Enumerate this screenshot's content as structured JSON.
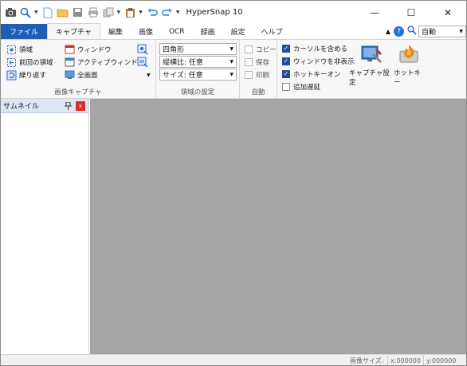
{
  "app": {
    "title": "HyperSnap 10"
  },
  "window_controls": {
    "minimize": "—",
    "maximize": "☐",
    "close": "✕"
  },
  "tabs": [
    {
      "label": "ファイル"
    },
    {
      "label": "キャプチャ"
    },
    {
      "label": "編集"
    },
    {
      "label": "画像"
    },
    {
      "label": "OCR"
    },
    {
      "label": "録画"
    },
    {
      "label": "設定"
    },
    {
      "label": "ヘルプ"
    }
  ],
  "zoom": {
    "value": "自動"
  },
  "ribbon": {
    "capture_group": {
      "label": "画像キャプチャ",
      "region": "領域",
      "prev_region": "前回の領域",
      "repeat": "繰り返す",
      "window": "ウィンドウ",
      "active_window": "アクティブウィンドウ",
      "full_screen": "全画面"
    },
    "region_group": {
      "label": "領域の設定",
      "shape": "四角形",
      "aspect": "縦横比: 任意",
      "size": "サイズ: 任意"
    },
    "auto_group": {
      "label": "自動",
      "copy": "コピー",
      "save": "保存",
      "print": "印刷"
    },
    "options_group": {
      "include_cursor": "カーソルを含める",
      "hide_window": "ウィンドウを非表示",
      "hotkey_on": "ホットキーオン",
      "add_delay": "追加遅延"
    },
    "big_buttons": {
      "capture_settings": "キャプチャ設定",
      "hotkeys": "ホットキー"
    }
  },
  "side_panel": {
    "title": "サムネイル",
    "close": "x"
  },
  "status": {
    "image_size_label": "画像サイズ:",
    "x": "x:000000",
    "y": "y:000000"
  },
  "colors": {
    "accent": "#1e5fb4",
    "canvas": "#a5a5a5",
    "check": "#1f4e9c"
  }
}
